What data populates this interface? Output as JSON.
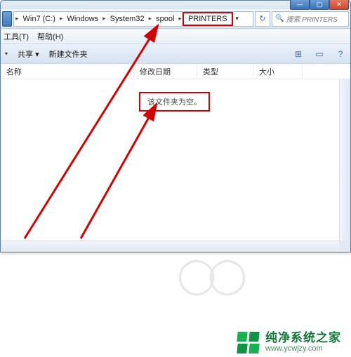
{
  "window": {
    "min": "—",
    "max": "▢",
    "close": "✕"
  },
  "breadcrumbs": {
    "items": [
      "Win7 (C:)",
      "Windows",
      "System32",
      "spool",
      "PRINTERS"
    ],
    "sep": "▸",
    "dropdown": "▾",
    "refresh": "↻"
  },
  "search": {
    "icon": "🔍",
    "placeholder": "搜索 PRINTERS"
  },
  "menu": {
    "tools": "工具(T)",
    "help": "帮助(H)"
  },
  "toolbar": {
    "share": "共享 ▾",
    "newfolder": "新建文件夹",
    "dd": "▾",
    "view_ic": "⊞",
    "help_ic": "?"
  },
  "columns": {
    "name": "名称",
    "date": "修改日期",
    "type": "类型",
    "size": "大小"
  },
  "content": {
    "empty": "该文件夹为空。"
  },
  "watermark": {
    "cn": "纯净系统之家",
    "url": "www.ycwjzy.com"
  }
}
